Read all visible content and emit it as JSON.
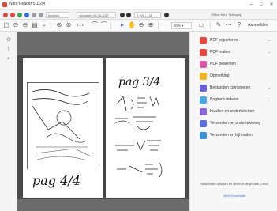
{
  "titlebar": {
    "title": "Nitro Reader 5 1/2/4",
    "minimize": "–",
    "maximize": "□",
    "close": "✕"
  },
  "quickbar": {
    "field1": "bestand",
    "field2": "uploaden 05-08-2017",
    "field3": "1 100 / 128",
    "right_text": "Office Nitro Toeleging"
  },
  "toolbar": {
    "zoom": "60% ▾",
    "signin": "Aanmelden"
  },
  "tools": [
    {
      "label": "PDF exporteren",
      "color": "#e04a3f",
      "chev": "⌄"
    },
    {
      "label": "PDF maken",
      "color": "#e0473f",
      "chev": "⌄"
    },
    {
      "label": "PDF bewerken",
      "color": "#d65aa6",
      "chev": ""
    },
    {
      "label": "Opmerking",
      "color": "#f0b429",
      "chev": ""
    },
    {
      "label": "Bestanden combineren",
      "color": "#6a63d6",
      "chev": "⌄"
    },
    {
      "label": "Pagina's indelen",
      "color": "#4aa8e0",
      "chev": "⌄"
    },
    {
      "label": "Invullen en ondertekenen",
      "color": "#8a63d6",
      "chev": ""
    },
    {
      "label": "Verzenden ter ondertekening",
      "color": "#5a6fd6",
      "chev": ""
    },
    {
      "label": "Verzenden en bijhouden",
      "color": "#3d8fd6",
      "chev": ""
    }
  ],
  "panel": {
    "note": "Bestanden opslaan en delen in de private Cloud",
    "link": "Meer informatie"
  },
  "pages": {
    "left_text": "pag 4/4",
    "right_text": "pag 3/4"
  }
}
